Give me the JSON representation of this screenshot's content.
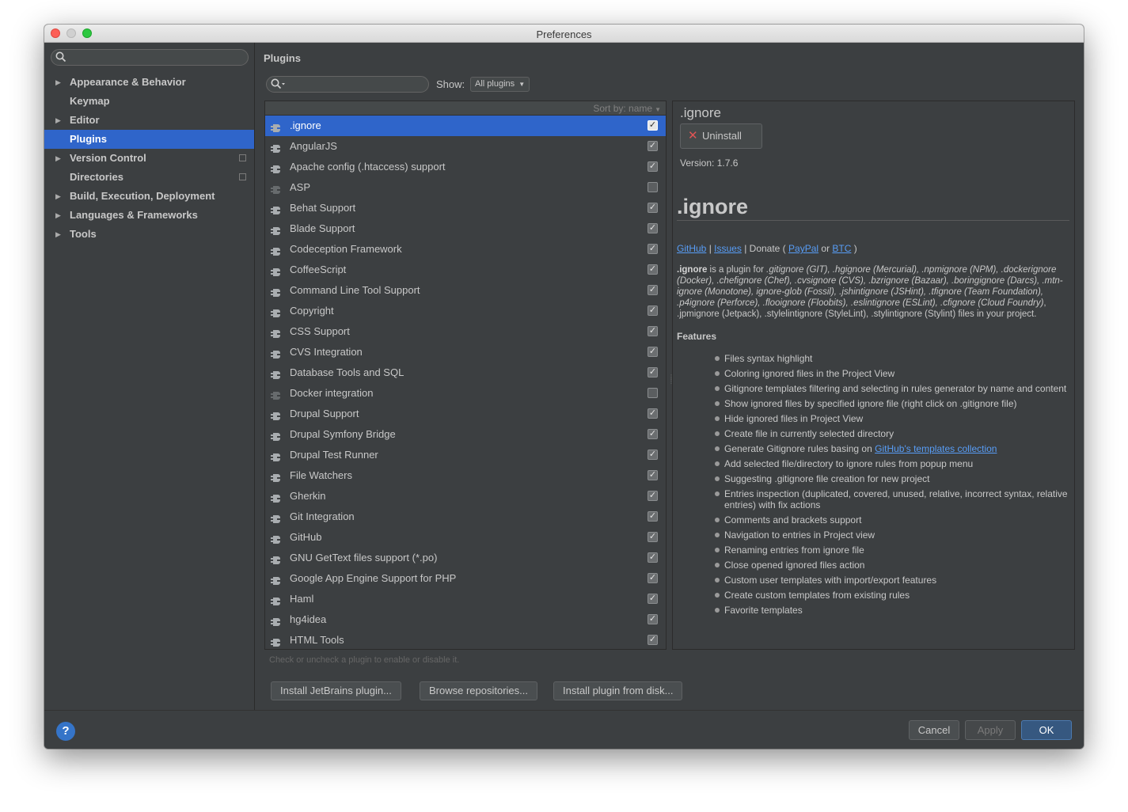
{
  "window": {
    "title": "Preferences"
  },
  "sidebar": {
    "search_placeholder": "",
    "items": [
      {
        "label": "Appearance & Behavior",
        "expandable": true
      },
      {
        "label": "Keymap",
        "expandable": false
      },
      {
        "label": "Editor",
        "expandable": true
      },
      {
        "label": "Plugins",
        "expandable": false,
        "selected": true
      },
      {
        "label": "Version Control",
        "expandable": true,
        "project_icon": "copy-icon"
      },
      {
        "label": "Directories",
        "expandable": false,
        "project_icon": "copy-icon"
      },
      {
        "label": "Build, Execution, Deployment",
        "expandable": true
      },
      {
        "label": "Languages & Frameworks",
        "expandable": true
      },
      {
        "label": "Tools",
        "expandable": true
      }
    ]
  },
  "plugins": {
    "heading": "Plugins",
    "search_placeholder": "",
    "show_label": "Show:",
    "show_value": "All plugins",
    "sort_label": "Sort by: name",
    "list": [
      {
        "name": ".ignore",
        "enabled": true,
        "selected": true
      },
      {
        "name": "AngularJS",
        "enabled": true
      },
      {
        "name": "Apache config (.htaccess) support",
        "enabled": true
      },
      {
        "name": "ASP",
        "enabled": false
      },
      {
        "name": "Behat Support",
        "enabled": true
      },
      {
        "name": "Blade Support",
        "enabled": true
      },
      {
        "name": "Codeception Framework",
        "enabled": true
      },
      {
        "name": "CoffeeScript",
        "enabled": true
      },
      {
        "name": "Command Line Tool Support",
        "enabled": true
      },
      {
        "name": "Copyright",
        "enabled": true
      },
      {
        "name": "CSS Support",
        "enabled": true
      },
      {
        "name": "CVS Integration",
        "enabled": true
      },
      {
        "name": "Database Tools and SQL",
        "enabled": true
      },
      {
        "name": "Docker integration",
        "enabled": false
      },
      {
        "name": "Drupal Support",
        "enabled": true
      },
      {
        "name": "Drupal Symfony Bridge",
        "enabled": true
      },
      {
        "name": "Drupal Test Runner",
        "enabled": true
      },
      {
        "name": "File Watchers",
        "enabled": true
      },
      {
        "name": "Gherkin",
        "enabled": true
      },
      {
        "name": "Git Integration",
        "enabled": true
      },
      {
        "name": "GitHub",
        "enabled": true
      },
      {
        "name": "GNU GetText files support (*.po)",
        "enabled": true
      },
      {
        "name": "Google App Engine Support for PHP",
        "enabled": true
      },
      {
        "name": "Haml",
        "enabled": true
      },
      {
        "name": "hg4idea",
        "enabled": true
      },
      {
        "name": "HTML Tools",
        "enabled": true
      }
    ],
    "hint": "Check or uncheck a plugin to enable or disable it.",
    "buttons": {
      "install_jetbrains": "Install JetBrains plugin...",
      "browse": "Browse repositories...",
      "install_disk": "Install plugin from disk..."
    }
  },
  "detail": {
    "name": ".ignore",
    "uninstall_label": "Uninstall",
    "version": "Version: 1.7.6",
    "title": ".ignore",
    "links": {
      "github": "GitHub",
      "sep1": "|",
      "issues": "Issues",
      "donate": "| Donate (",
      "paypal": "PayPal",
      "or": "or",
      "btc": "BTC",
      "close": ")"
    },
    "description": {
      "lead": ".ignore",
      "text1": " is a plugin for ",
      "files1": ".gitignore (GIT), .hgignore (Mercurial), .npmignore (NPM), .dockerignore (Docker), .chefignore (Chef), .cvsignore (CVS), .bzrignore (Bazaar), .boringignore (Darcs), .mtn-ignore (Monotone), ignore-glob (Fossil), .jshintignore (JSHint), .tfignore (Team Foundation), .p4ignore (Perforce), .flooignore (Floobits), .eslintignore (ESLint), .cfignore (Cloud Foundry)",
      "text2": ", .jpmignore (Jetpack), .stylelintignore (StyleLint), .stylintignore (Stylint) files in your project."
    },
    "features_title": "Features",
    "features": [
      "Files syntax highlight",
      "Coloring ignored files in the Project View",
      "Gitignore templates filtering and selecting in rules generator by name and content",
      "Show ignored files by specified ignore file (right click on .gitignore file)",
      "Hide ignored files in Project View",
      "Create file in currently selected directory",
      "Generate Gitignore rules basing on ",
      "Add selected file/directory to ignore rules from popup menu",
      "Suggesting .gitignore file creation for new project",
      "Entries inspection (duplicated, covered, unused, relative, incorrect syntax, relative entries) with fix actions",
      "Comments and brackets support",
      "Navigation to entries in Project view",
      "Renaming entries from ignore file",
      "Close opened ignored files action",
      "Custom user templates with import/export features",
      "Create custom templates from existing rules",
      "Favorite templates"
    ],
    "templates_link": "GitHub's templates collection"
  },
  "footer": {
    "help": "?",
    "cancel": "Cancel",
    "apply": "Apply",
    "ok": "OK"
  },
  "colors": {
    "background": "#3c3f41",
    "selection": "#2f65ca",
    "link": "#589df6",
    "ok_button": "#365880"
  }
}
